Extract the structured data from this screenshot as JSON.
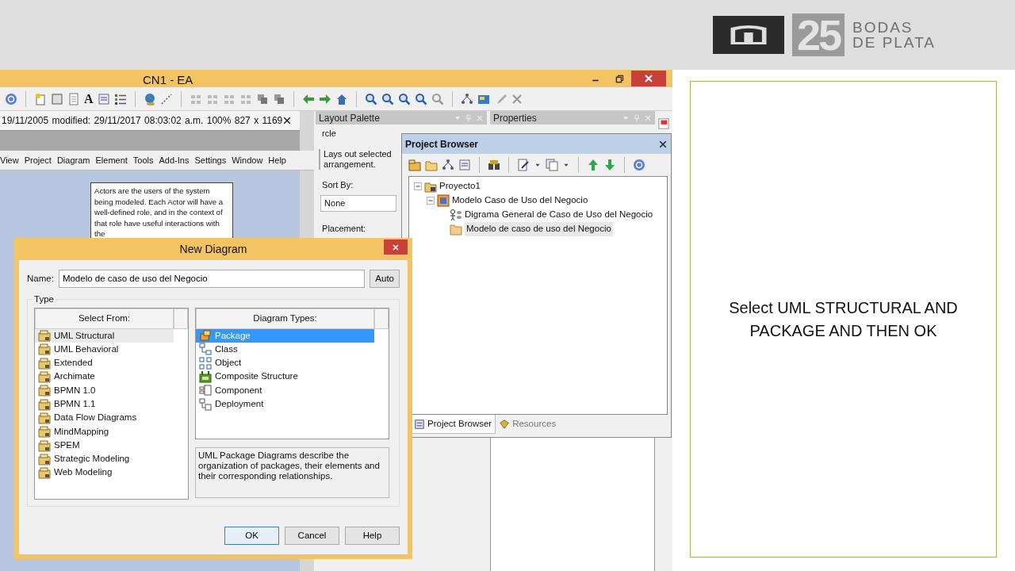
{
  "slide": {
    "logo": {
      "number": "25",
      "line1": "BODAS",
      "line2": "DE PLATA"
    },
    "instruction": "Select UML STRUCTURAL AND PACKAGE AND THEN OK"
  },
  "app": {
    "title": "CN1 - EA",
    "toolbar_letter": "A",
    "doc_info": "19/11/2005 modified: 29/11/2017 08:03:02 a.m.",
    "zoom": "100%",
    "page_size": "827 x 1169",
    "menu": [
      "View",
      "Project",
      "Diagram",
      "Element",
      "Tools",
      "Add-Ins",
      "Settings",
      "Window",
      "Help"
    ],
    "note": "Actors are the users of the system being modeled. Each Actor will have a well-defined role, and in the context of that role have useful interactions with the"
  },
  "layout_palette": {
    "title": "Layout Palette",
    "layout": "rcle",
    "description": "Lays out selected arrangement.",
    "sort_label": "Sort By:",
    "sort_value": "None",
    "placement_label": "Placement:"
  },
  "properties": {
    "title": "Properties"
  },
  "project_browser": {
    "title": "Project Browser",
    "tree": [
      {
        "label": "Proyecto1",
        "kind": "project",
        "selected": false,
        "expanded": true,
        "children": [
          {
            "label": "Modelo Caso de Uso del Negocio",
            "kind": "model",
            "selected": false,
            "expanded": true,
            "children": [
              {
                "label": "Digrama General de Caso de Uso del Negocio",
                "kind": "diagram",
                "selected": false
              },
              {
                "label": "Modelo de caso de uso del Negocio",
                "kind": "folder",
                "selected": true
              }
            ]
          }
        ]
      }
    ],
    "tabs": [
      {
        "label": "Project Browser",
        "selected": true
      },
      {
        "label": "Resources",
        "selected": false
      }
    ]
  },
  "dialog": {
    "title": "New Diagram",
    "name_label": "Name:",
    "name_value": "Modelo de caso de uso del Negocio",
    "auto_button": "Auto",
    "type_label": "Type",
    "select_from": {
      "heading": "Select From:",
      "items": [
        {
          "label": "UML Structural",
          "selected": true
        },
        {
          "label": "UML Behavioral",
          "selected": false
        },
        {
          "label": "Extended",
          "selected": false
        },
        {
          "label": "Archimate",
          "selected": false
        },
        {
          "label": "BPMN 1.0",
          "selected": false
        },
        {
          "label": "BPMN 1.1",
          "selected": false
        },
        {
          "label": "Data Flow Diagrams",
          "selected": false
        },
        {
          "label": "MindMapping",
          "selected": false
        },
        {
          "label": "SPEM",
          "selected": false
        },
        {
          "label": "Strategic Modeling",
          "selected": false
        },
        {
          "label": "Web Modeling",
          "selected": false
        }
      ]
    },
    "diagram_types": {
      "heading": "Diagram Types:",
      "items": [
        {
          "label": "Package",
          "kind": "package",
          "selected": true
        },
        {
          "label": "Class",
          "kind": "class",
          "selected": false
        },
        {
          "label": "Object",
          "kind": "object",
          "selected": false
        },
        {
          "label": "Composite Structure",
          "kind": "composite",
          "selected": false
        },
        {
          "label": "Component",
          "kind": "component",
          "selected": false
        },
        {
          "label": "Deployment",
          "kind": "deployment",
          "selected": false
        }
      ]
    },
    "description": "UML Package Diagrams describe the organization of packages, their elements and their corresponding relationships.",
    "buttons": [
      {
        "label": "OK",
        "default": true
      },
      {
        "label": "Cancel",
        "default": false
      },
      {
        "label": "Help",
        "default": false
      }
    ]
  }
}
